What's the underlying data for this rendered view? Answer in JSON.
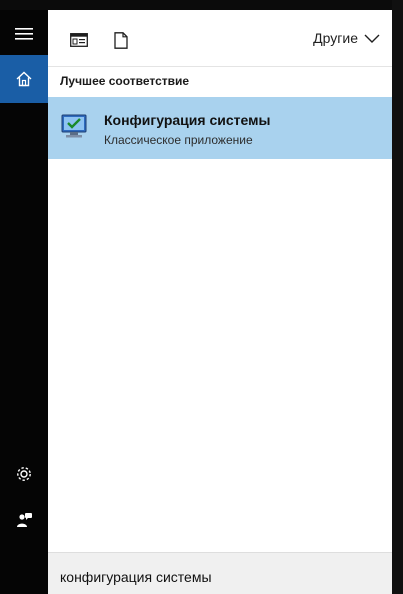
{
  "colors": {
    "rail_bg": "#050505",
    "accent": "#1a5ea6",
    "result_highlight": "#a9d2ee",
    "panel_bg": "#ffffff",
    "search_bg": "#f0f0f0"
  },
  "rail": {
    "items": [
      {
        "icon": "hamburger-menu-icon"
      },
      {
        "icon": "home-icon",
        "selected": true
      },
      {
        "icon": "gear-icon"
      },
      {
        "icon": "feedback-icon"
      }
    ]
  },
  "toolbar": {
    "filters": [
      {
        "icon": "apps-filter-icon"
      },
      {
        "icon": "documents-filter-icon"
      }
    ],
    "others_label": "Другие"
  },
  "results": {
    "section_title": "Лучшее соответствие",
    "best_match": {
      "title": "Конфигурация системы",
      "subtitle": "Классическое приложение",
      "icon": "system-configuration-app-icon"
    }
  },
  "search": {
    "query": "конфигурация системы"
  }
}
